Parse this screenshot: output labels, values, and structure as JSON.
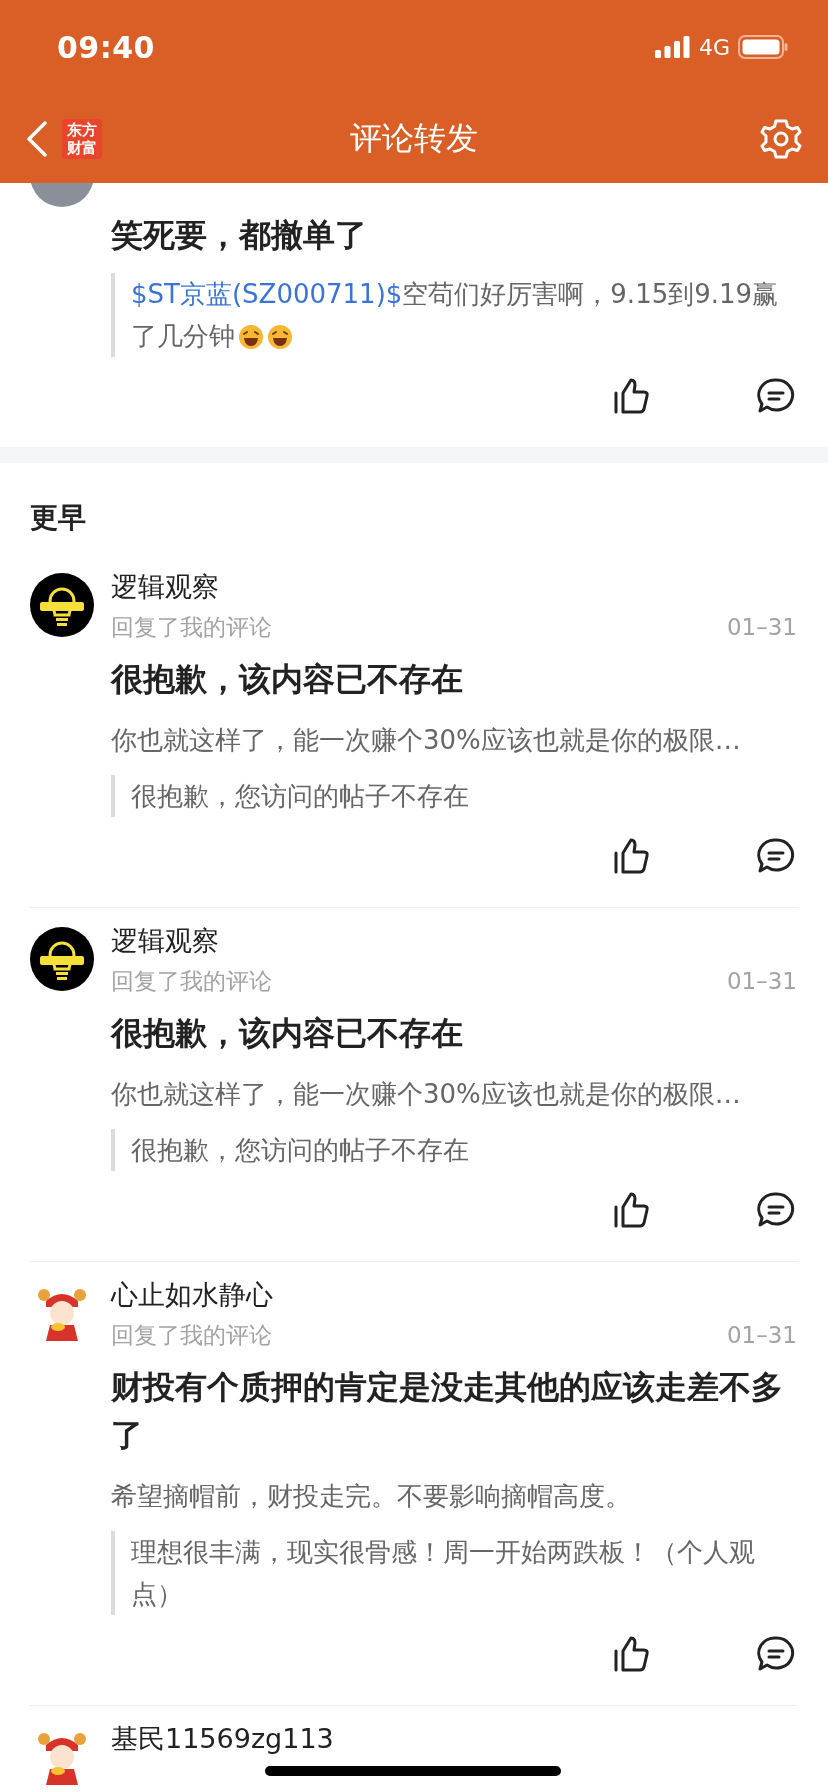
{
  "status_bar": {
    "time": "09:40",
    "network": "4G"
  },
  "header": {
    "logo": [
      "东方",
      "财富"
    ],
    "title": "评论转发"
  },
  "recent": [
    {
      "avatar": {
        "kind": "gray"
      },
      "comment": "笑死要，都撤单了",
      "quote": {
        "link": "$ST京蓝(SZ000711)$",
        "text": "空苟们好厉害啊，9.15到9.19赢了几分钟",
        "emojis": [
          {
            "kind": "laughing"
          },
          {
            "kind": "laughing"
          }
        ]
      }
    }
  ],
  "section_heading": "更早",
  "earlier": [
    {
      "avatar": {
        "kind": "logo"
      },
      "user": "逻辑观察",
      "action": "回复了我的评论",
      "time": "01–31",
      "comment": "很抱歉，该内容已不存在",
      "reply": "你也就这样了，能一次赚个30%应该也就是你的极限…",
      "quote": {
        "text": "很抱歉，您访问的帖子不存在"
      }
    },
    {
      "avatar": {
        "kind": "logo"
      },
      "user": "逻辑观察",
      "action": "回复了我的评论",
      "time": "01–31",
      "comment": "很抱歉，该内容已不存在",
      "reply": "你也就这样了，能一次赚个30%应该也就是你的极限…",
      "quote": {
        "text": "很抱歉，您访问的帖子不存在"
      }
    },
    {
      "avatar": {
        "kind": "cartoon"
      },
      "user": "心止如水静心",
      "action": "回复了我的评论",
      "time": "01–31",
      "comment": "财投有个质押的肯定是没走其他的应该走差不多了",
      "reply": "希望摘帽前，财投走完。不要影响摘帽高度。",
      "quote": {
        "text": "理想很丰满，现实很骨感！周一开始两跌板！（个人观点）"
      }
    },
    {
      "avatar": {
        "kind": "cartoon"
      },
      "user": "基民11569zg113"
    }
  ]
}
